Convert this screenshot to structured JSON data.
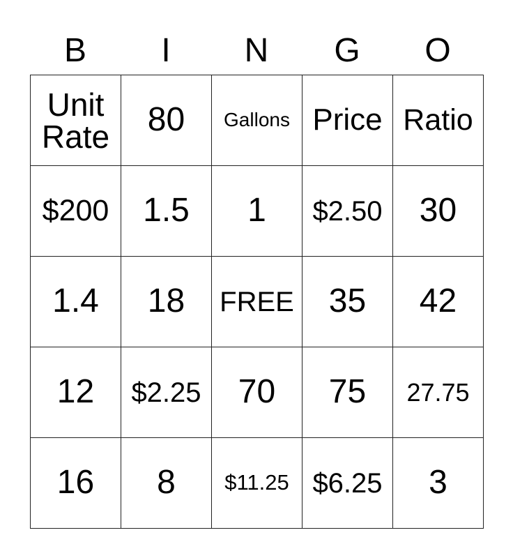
{
  "header": [
    "B",
    "I",
    "N",
    "G",
    "O"
  ],
  "rows": [
    [
      "Unit Rate",
      "80",
      "Gallons",
      "Price",
      "Ratio"
    ],
    [
      "$200",
      "1.5",
      "1",
      "$2.50",
      "30"
    ],
    [
      "1.4",
      "18",
      "FREE",
      "35",
      "42"
    ],
    [
      "12",
      "$2.25",
      "70",
      "75",
      "27.75"
    ],
    [
      "16",
      "8",
      "$11.25",
      "$6.25",
      "3"
    ]
  ]
}
